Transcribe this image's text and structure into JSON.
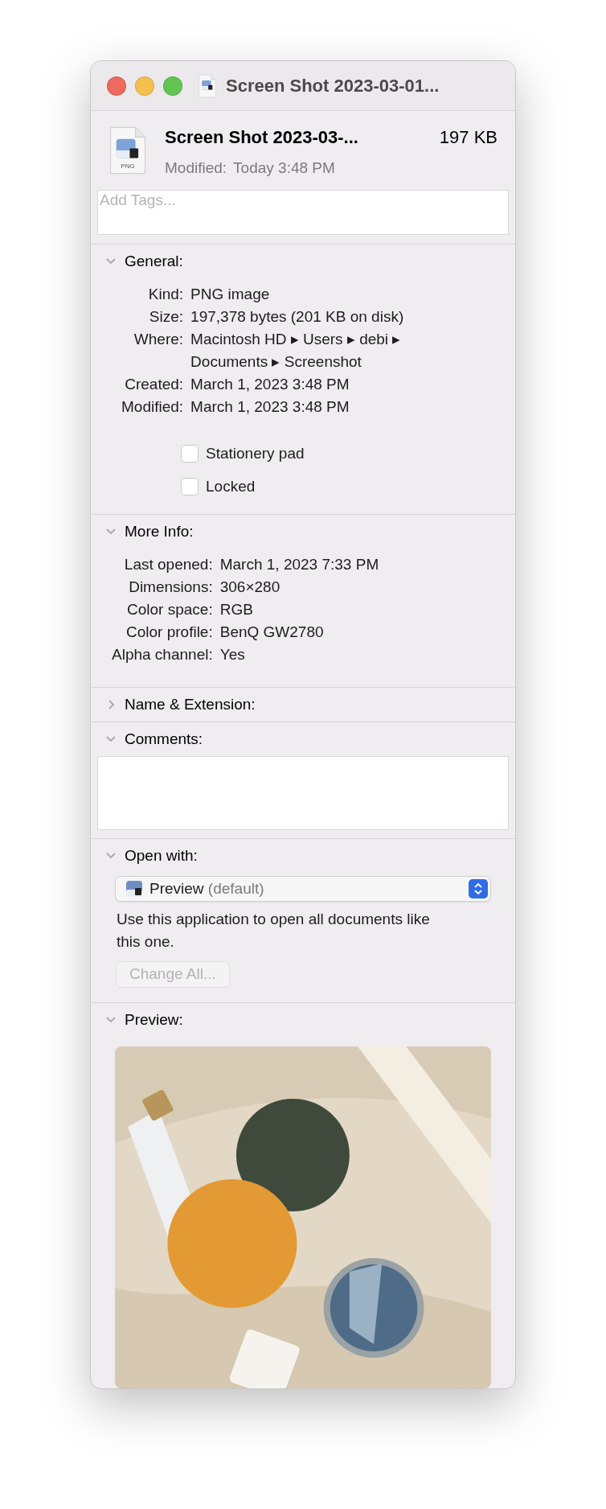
{
  "window": {
    "title": "Screen Shot 2023-03-01..."
  },
  "header": {
    "name": "Screen Shot 2023-03-...",
    "size": "197 KB",
    "modified_label": "Modified:",
    "modified_value": "Today 3:48 PM",
    "icon_label": "PNG"
  },
  "tags": {
    "placeholder": "Add Tags..."
  },
  "sections": [
    {
      "kind": "info",
      "title": "General:",
      "expanded": true,
      "rows": [
        {
          "label": "Kind:",
          "value": "PNG image"
        },
        {
          "label": "Size:",
          "value": "197,378 bytes (201 KB on disk)"
        },
        {
          "label": "Where:",
          "value": "Macintosh HD ▸ Users ▸ debi ▸ Documents ▸ Screenshot"
        },
        {
          "label": "Created:",
          "value": "March 1, 2023 3:48 PM"
        },
        {
          "label": "Modified:",
          "value": "March 1, 2023 3:48 PM"
        }
      ],
      "checkboxes": [
        {
          "label": "Stationery pad",
          "checked": false
        },
        {
          "label": "Locked",
          "checked": false
        }
      ]
    },
    {
      "kind": "info",
      "title": "More Info:",
      "expanded": true,
      "rows": [
        {
          "label": "Last opened:",
          "value": "March 1, 2023 7:33 PM"
        },
        {
          "label": "Dimensions:",
          "value": "306×280"
        },
        {
          "label": "Color space:",
          "value": "RGB"
        },
        {
          "label": "Color profile:",
          "value": "BenQ GW2780"
        },
        {
          "label": "Alpha channel:",
          "value": "Yes"
        }
      ]
    },
    {
      "kind": "info",
      "title": "Name & Extension:",
      "expanded": false
    },
    {
      "kind": "comments",
      "title": "Comments:",
      "expanded": true
    },
    {
      "kind": "open_with",
      "title": "Open with:",
      "expanded": true,
      "app": "Preview",
      "app_note": "(default)",
      "description": "Use this application to open all documents like this one.",
      "button": {
        "label": "Change All...",
        "disabled": true
      }
    },
    {
      "kind": "preview",
      "title": "Preview:",
      "expanded": true
    }
  ]
}
